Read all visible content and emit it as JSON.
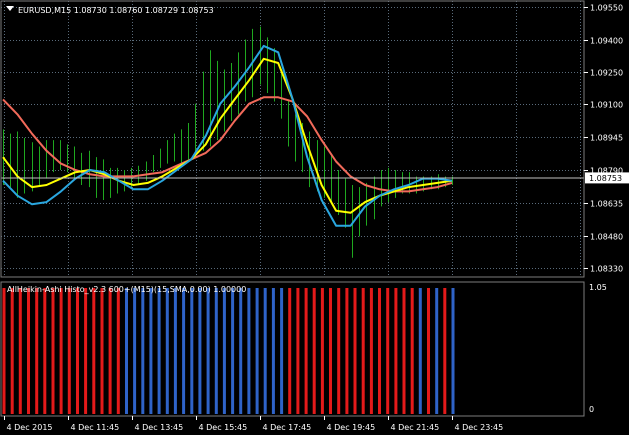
{
  "chart_data": [
    {
      "type": "line",
      "symbol": "EURUSD",
      "timeframe": "M15",
      "title": "EURUSD,M15  1.08730 1.08760 1.08729 1.08753",
      "ohlc": {
        "open": 1.0873,
        "high": 1.0876,
        "low": 1.08729,
        "close": 1.08753
      },
      "current_price_label": "1.08753",
      "current_price": 1.08753,
      "ylim": [
        1.0829,
        1.0958
      ],
      "yticks": [
        "1.09550",
        "1.09400",
        "1.09250",
        "1.09100",
        "1.08945",
        "1.08790",
        "1.08635",
        "1.08480",
        "1.08330"
      ],
      "ytick_values": [
        1.0955,
        1.094,
        1.0925,
        1.091,
        1.08945,
        1.0879,
        1.08635,
        1.0848,
        1.0833
      ],
      "xticks": [
        "4 Dec 2015",
        "4 Dec 11:45",
        "4 Dec 13:45",
        "4 Dec 15:45",
        "4 Dec 17:45",
        "4 Dec 19:45",
        "4 Dec 21:45",
        "4 Dec 23:45"
      ],
      "grid": true,
      "colors": {
        "bars": "#1fa81f",
        "line_fast": "#2aa7e0",
        "line_mid": "#ffff00",
        "line_slow": "#f26a5a",
        "grid": "#5a6b7b",
        "price_line": "#c0c0c0"
      },
      "bars": [
        [
          1.0898,
          1.0872
        ],
        [
          1.0896,
          1.0871
        ],
        [
          1.0897,
          1.0866
        ],
        [
          1.0894,
          1.0868
        ],
        [
          1.0892,
          1.0869
        ],
        [
          1.089,
          1.0872
        ],
        [
          1.0893,
          1.0875
        ],
        [
          1.0893,
          1.0878
        ],
        [
          1.0893,
          1.0879
        ],
        [
          1.0891,
          1.0878
        ],
        [
          1.089,
          1.0875
        ],
        [
          1.0887,
          1.0872
        ],
        [
          1.0888,
          1.0871
        ],
        [
          1.0885,
          1.0866
        ],
        [
          1.0884,
          1.0865
        ],
        [
          1.088,
          1.0866
        ],
        [
          1.088,
          1.0868
        ],
        [
          1.0879,
          1.0869
        ],
        [
          1.088,
          1.087
        ],
        [
          1.0881,
          1.0872
        ],
        [
          1.0883,
          1.0874
        ],
        [
          1.0886,
          1.0878
        ],
        [
          1.0889,
          1.088
        ],
        [
          1.0893,
          1.0882
        ],
        [
          1.0896,
          1.0883
        ],
        [
          1.0898,
          1.0881
        ],
        [
          1.0901,
          1.0884
        ],
        [
          1.091,
          1.0885
        ],
        [
          1.0925,
          1.0888
        ],
        [
          1.0935,
          1.089
        ],
        [
          1.093,
          1.0893
        ],
        [
          1.0926,
          1.0897
        ],
        [
          1.0929,
          1.0902
        ],
        [
          1.0934,
          1.0905
        ],
        [
          1.094,
          1.0911
        ],
        [
          1.0945,
          1.0913
        ],
        [
          1.0946,
          1.0919
        ],
        [
          1.0941,
          1.0915
        ],
        [
          1.0936,
          1.0911
        ],
        [
          1.0926,
          1.0903
        ],
        [
          1.0912,
          1.089
        ],
        [
          1.0905,
          1.0883
        ],
        [
          1.0901,
          1.0878
        ],
        [
          1.0897,
          1.0871
        ],
        [
          1.0893,
          1.0869
        ],
        [
          1.089,
          1.0866
        ],
        [
          1.0886,
          1.0863
        ],
        [
          1.0879,
          1.0858
        ],
        [
          1.0875,
          1.0852
        ],
        [
          1.0872,
          1.0838
        ],
        [
          1.0871,
          1.0848
        ],
        [
          1.0873,
          1.0853
        ],
        [
          1.0876,
          1.0856
        ],
        [
          1.0879,
          1.0862
        ],
        [
          1.088,
          1.0864
        ],
        [
          1.0879,
          1.0866
        ],
        [
          1.0878,
          1.0868
        ],
        [
          1.0878,
          1.0868
        ],
        [
          1.0876,
          1.0868
        ],
        [
          1.0876,
          1.0869
        ],
        [
          1.0876,
          1.087
        ],
        [
          1.0877,
          1.087
        ],
        [
          1.0876,
          1.0871
        ],
        [
          1.0876,
          1.0872
        ]
      ],
      "series": [
        {
          "color": "line_fast",
          "values": [
            1.0874,
            1.0867,
            1.0863,
            1.0864,
            1.0869,
            1.0875,
            1.0879,
            1.0878,
            1.0874,
            1.087,
            1.087,
            1.0874,
            1.0879,
            1.0884,
            1.0895,
            1.091,
            1.0918,
            1.0927,
            1.0937,
            1.0934,
            1.0912,
            1.0885,
            1.0865,
            1.0853,
            1.0853,
            1.0862,
            1.0867,
            1.087,
            1.0872,
            1.0875,
            1.0875,
            1.0874
          ]
        },
        {
          "color": "line_mid",
          "values": [
            1.0885,
            1.0876,
            1.0871,
            1.0872,
            1.0875,
            1.0878,
            1.0879,
            1.0877,
            1.0874,
            1.0872,
            1.0873,
            1.0876,
            1.088,
            1.0884,
            1.0891,
            1.0903,
            1.0912,
            1.0921,
            1.0931,
            1.0929,
            1.0912,
            1.0891,
            1.0872,
            1.086,
            1.0859,
            1.0864,
            1.0867,
            1.0869,
            1.0871,
            1.0872,
            1.0873,
            1.0874
          ]
        },
        {
          "color": "line_slow",
          "values": [
            1.0912,
            1.0905,
            1.0896,
            1.0888,
            1.0882,
            1.0879,
            1.0877,
            1.0876,
            1.0876,
            1.0876,
            1.0877,
            1.0878,
            1.0881,
            1.0884,
            1.0887,
            1.0893,
            1.0902,
            1.091,
            1.0913,
            1.0913,
            1.0911,
            1.0904,
            1.0893,
            1.0883,
            1.0876,
            1.0872,
            1.087,
            1.0869,
            1.0869,
            1.087,
            1.0871,
            1.0873
          ]
        }
      ]
    },
    {
      "type": "bar",
      "title": "AllHeikin-Ashi Histo_v2.3 600+(M15)(15,SMA,0.00) 1.00000",
      "yticks": [
        "1.05",
        "0"
      ],
      "ylim": [
        0,
        1.05
      ],
      "colors": {
        "up": "#2f63c8",
        "down": "#e41a1a"
      },
      "bars": [
        {
          "color": "down",
          "count": 15
        },
        {
          "color": "up",
          "count": 20
        },
        {
          "color": "down",
          "count": 16
        },
        {
          "color": "up",
          "count": 1
        },
        {
          "color": "down",
          "count": 1
        },
        {
          "color": "up",
          "count": 1
        },
        {
          "color": "down",
          "count": 1
        },
        {
          "color": "up",
          "count": 1
        }
      ]
    }
  ]
}
